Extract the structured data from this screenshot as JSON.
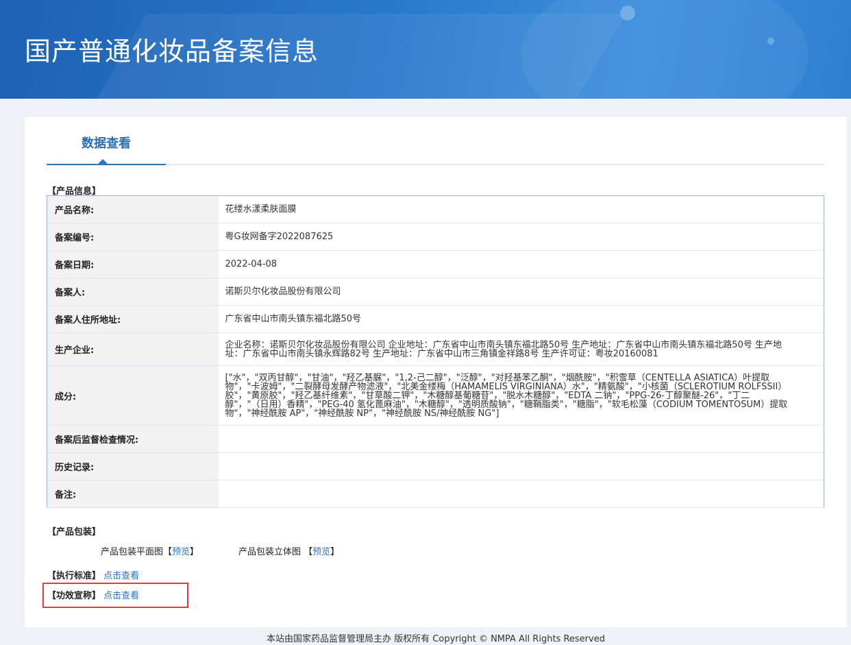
{
  "header": {
    "title": "国产普通化妆品备案信息"
  },
  "tab": {
    "label": "数据查看"
  },
  "sections": {
    "product_info": "【产品信息】",
    "packaging": "【产品包装】",
    "standard": "【执行标准】",
    "efficacy": "【功效宣称】"
  },
  "product_info": {
    "rows": [
      {
        "key": "产品名称:",
        "value": "花缕水漾柔肤面膜"
      },
      {
        "key": "备案编号:",
        "value": "粤G妆网备字2022087625"
      },
      {
        "key": "备案日期:",
        "value": "2022-04-08"
      },
      {
        "key": "备案人:",
        "value": "诺斯贝尔化妆品股份有限公司"
      },
      {
        "key": "备案人住所地址:",
        "value": "广东省中山市南头镇东福北路50号"
      },
      {
        "key": "生产企业:",
        "value": "企业名称：诺斯贝尔化妆品股份有限公司 企业地址：广东省中山市南头镇东福北路50号 生产地址：广东省中山市南头镇东福北路50号 生产地址：广东省中山市南头镇永辉路82号 生产地址：广东省中山市三角镇金祥路8号 生产许可证：粤妆20160081"
      },
      {
        "key": "成分:",
        "value": "[\"水\"，\"双丙甘醇\"，\"甘油\"，\"羟乙基脲\"，\"1,2-己二醇\"，\"泛醇\"，\"对羟基苯乙酮\"，\"烟酰胺\"，\"积雪草（CENTELLA ASIATICA）叶提取物\"，\"卡波姆\"，\"二裂酵母发酵产物滤液\"，\"北美金缕梅（HAMAMELIS VIRGINIANA）水\"，\"精氨酸\"，\"小核菌（SCLEROTIUM ROLFSSII）胶\"，\"黄原胶\"，\"羟乙基纤维素\"，\"甘草酸二钾\"，\"木糖醇基葡糖苷\"，\"脱水木糖醇\"，\"EDTA 二钠\"，\"PPG-26-丁醇聚醚-26\"，\"丁二醇\"，\"（日用）香精\"，\"PEG-40 氢化蓖麻油\"，\"木糖醇\"，\"透明质酸钠\"，\"糖鞘脂类\"，\"糖脂\"，\"软毛松藻（CODIUM TOMENTOSUM）提取物\"，\"神经酰胺 AP\"，\"神经酰胺 NP\"，\"神经酰胺 NS/神经酰胺 NG\"]"
      },
      {
        "key": "备案后监督检查情况:",
        "value": ""
      },
      {
        "key": "历史记录:",
        "value": ""
      },
      {
        "key": "备注:",
        "value": ""
      }
    ]
  },
  "packaging": {
    "flat_label": "产品包装平面图",
    "flat_link": "预览",
    "solid_label": "产品包装立体图",
    "solid_link": "预览",
    "bracket_open": "【",
    "bracket_close": "】"
  },
  "links": {
    "view": "点击查看"
  },
  "footer": {
    "text": "本站由国家药品监督管理局主办 版权所有 Copyright © NMPA All Rights Reserved"
  },
  "colors": {
    "accent": "#2a73c0",
    "banner": "#2a78cb",
    "highlight": "#e33b3b"
  }
}
